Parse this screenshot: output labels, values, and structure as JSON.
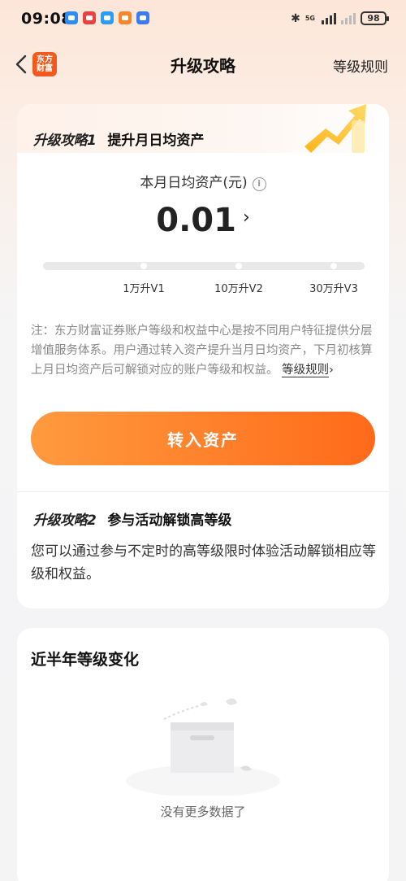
{
  "status_bar": {
    "time": "09:08",
    "network": "5G",
    "battery": "98"
  },
  "nav": {
    "logo_line1": "东方",
    "logo_line2": "财富",
    "title": "升级攻略",
    "rule_link": "等级规则"
  },
  "strategy1": {
    "tag": "升级攻略1",
    "title": "提升月日均资产",
    "asset_label": "本月日均资产(元)",
    "asset_value": "0.01",
    "levels": [
      "1万升V1",
      "10万升V2",
      "30万升V3"
    ],
    "note": "注：东方财富证券账户等级和权益中心是按不同用户特征提供分层增值服务体系。用户通过转入资产提升当月日均资产，下月初核算上月日均资产后可解锁对应的账户等级和权益。",
    "note_link": "等级规则",
    "cta": "转入资产"
  },
  "strategy2": {
    "tag": "升级攻略2",
    "title": "参与活动解锁高等级",
    "desc": "您可以通过参与不定时的高等级限时体验活动解锁相应等级和权益。"
  },
  "history": {
    "title": "近半年等级变化",
    "empty_text": "没有更多数据了"
  },
  "colors": {
    "brand_orange": "#ff6a1a",
    "cta_gradient_start": "#ff9a3e"
  }
}
